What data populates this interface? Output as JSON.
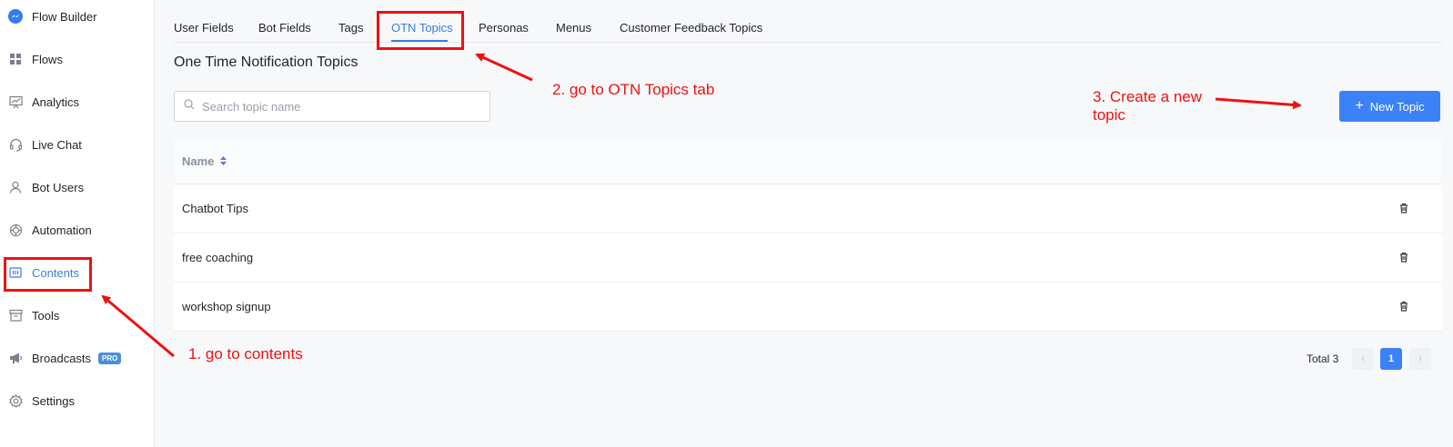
{
  "sidebar": {
    "items": [
      {
        "label": "Flow Builder",
        "icon": "messenger-icon"
      },
      {
        "label": "Flows",
        "icon": "grid-icon"
      },
      {
        "label": "Analytics",
        "icon": "chart-icon"
      },
      {
        "label": "Live Chat",
        "icon": "headset-icon"
      },
      {
        "label": "Bot Users",
        "icon": "user-icon"
      },
      {
        "label": "Automation",
        "icon": "automation-icon"
      },
      {
        "label": "Contents",
        "icon": "contents-icon"
      },
      {
        "label": "Tools",
        "icon": "toolbox-icon"
      },
      {
        "label": "Broadcasts",
        "icon": "megaphone-icon",
        "badge": "PRO"
      },
      {
        "label": "Settings",
        "icon": "gear-icon"
      }
    ],
    "active": "Contents"
  },
  "tabs": {
    "items": [
      "User Fields",
      "Bot Fields",
      "Tags",
      "OTN Topics",
      "Personas",
      "Menus",
      "Customer Feedback Topics"
    ],
    "active": "OTN Topics"
  },
  "page": {
    "title": "One Time Notification Topics"
  },
  "search": {
    "placeholder": "Search topic name",
    "value": ""
  },
  "new_button": {
    "label": "New Topic"
  },
  "table": {
    "header": "Name",
    "rows": [
      "Chatbot Tips",
      "free coaching",
      "workshop signup"
    ]
  },
  "pagination": {
    "total_label": "Total 3",
    "current_page": "1"
  },
  "annotations": {
    "step1": "1. go to contents",
    "step2": "2. go to OTN Topics tab",
    "step3": "3. Create a new topic"
  },
  "colors": {
    "accent": "#3b82f6",
    "annotation_red": "#ee1111"
  }
}
